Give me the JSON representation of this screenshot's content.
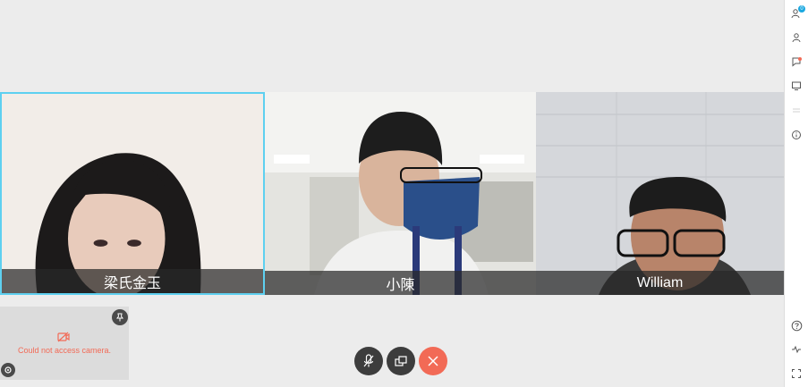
{
  "participants": [
    {
      "name": "梁氏金玉"
    },
    {
      "name": "小陳"
    },
    {
      "name": "William"
    }
  ],
  "self_view": {
    "message": "Could not access camera."
  },
  "rail": {
    "participants_badge": "0"
  },
  "colors": {
    "accent": "#5ed0f0",
    "end_call": "#f26a56",
    "badge": "#1aa8e0"
  },
  "icons": {
    "participants": "participants-icon",
    "contact": "person-icon",
    "chat": "chat-icon",
    "share": "monitor-icon",
    "info": "info-icon",
    "help": "help-icon",
    "stats": "activity-icon",
    "fullscreen": "fullscreen-icon",
    "mute": "mic-off-icon",
    "switch": "layout-icon",
    "end": "end-call-icon"
  }
}
